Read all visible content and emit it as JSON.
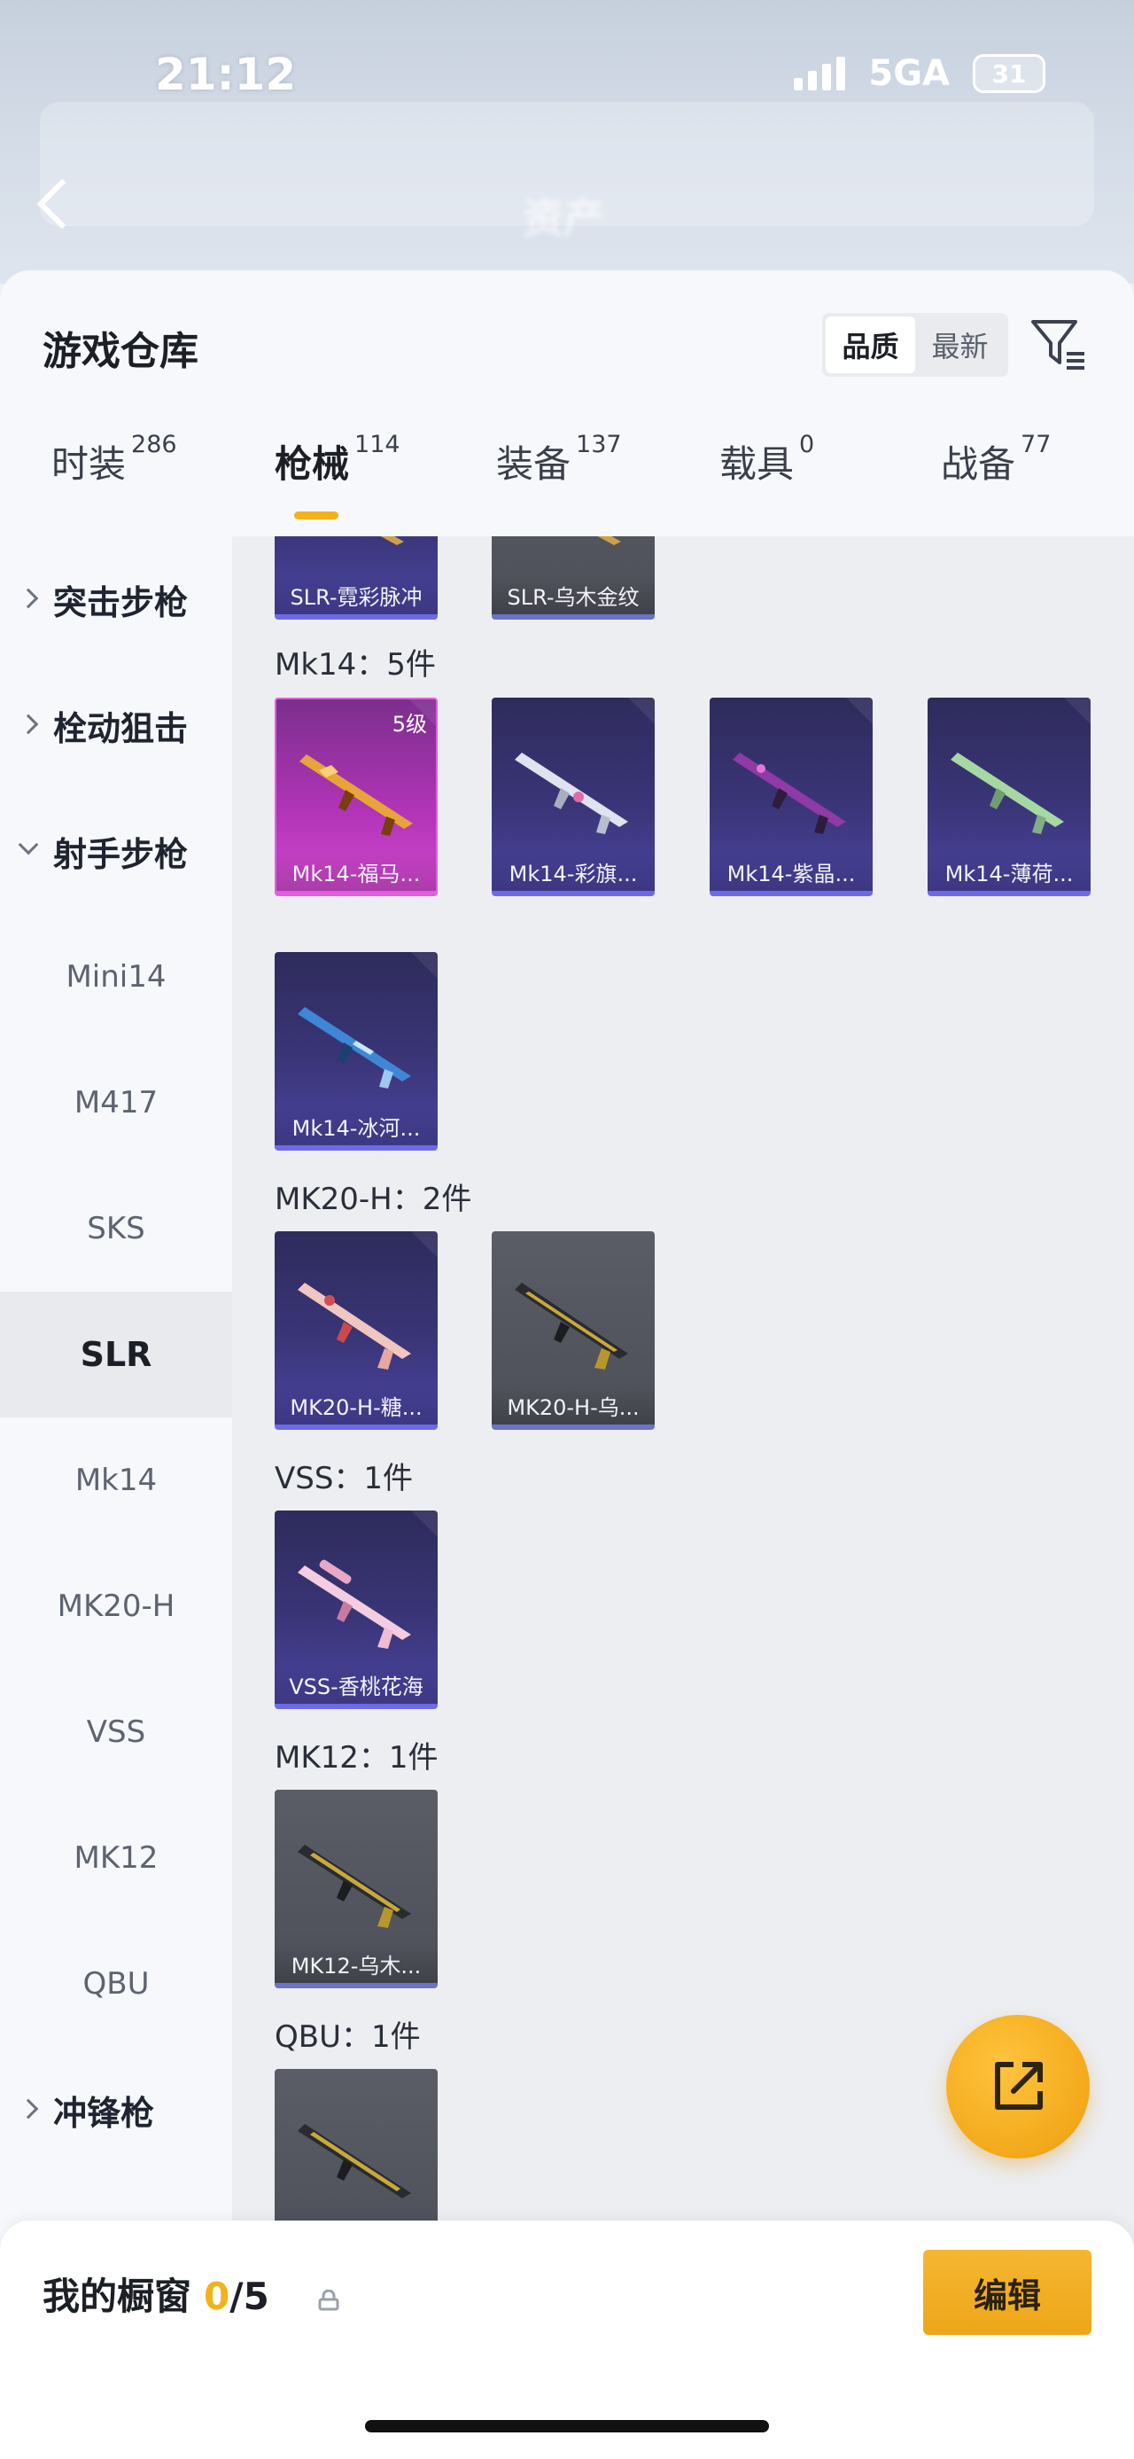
{
  "status_bar": {
    "time": "21:12",
    "network": "5GA",
    "battery": "31"
  },
  "background_header": {
    "title": "资产"
  },
  "header": {
    "title": "游戏仓库",
    "sort_options": [
      {
        "label": "品质",
        "active": true
      },
      {
        "label": "最新",
        "active": false
      }
    ]
  },
  "tabs": [
    {
      "label": "时装",
      "count": "286",
      "active": false
    },
    {
      "label": "枪械",
      "count": "114",
      "active": true
    },
    {
      "label": "装备",
      "count": "137",
      "active": false
    },
    {
      "label": "载具",
      "count": "0",
      "active": false
    },
    {
      "label": "战备",
      "count": "77",
      "active": false
    }
  ],
  "sidebar": {
    "items": [
      {
        "label": "突击步枪",
        "type": "group",
        "expanded": false
      },
      {
        "label": "栓动狙击",
        "type": "group",
        "expanded": false
      },
      {
        "label": "射手步枪",
        "type": "group",
        "expanded": true
      },
      {
        "label": "Mini14",
        "type": "sub"
      },
      {
        "label": "M417",
        "type": "sub"
      },
      {
        "label": "SKS",
        "type": "sub"
      },
      {
        "label": "SLR",
        "type": "sub",
        "active": true
      },
      {
        "label": "Mk14",
        "type": "sub"
      },
      {
        "label": "MK20-H",
        "type": "sub"
      },
      {
        "label": "VSS",
        "type": "sub"
      },
      {
        "label": "MK12",
        "type": "sub"
      },
      {
        "label": "QBU",
        "type": "sub"
      },
      {
        "label": "冲锋枪",
        "type": "group",
        "expanded": false
      }
    ]
  },
  "content": {
    "sections": [
      {
        "label": "",
        "items": [
          {
            "name": "SLR-霓彩脉冲",
            "quality": "purple"
          },
          {
            "name": "SLR-乌木金纹",
            "quality": "gray"
          }
        ]
      },
      {
        "label": "Mk14：5件",
        "items": [
          {
            "name": "Mk14-福马...",
            "quality": "pink",
            "level": "5级"
          },
          {
            "name": "Mk14-彩旗...",
            "quality": "purple"
          },
          {
            "name": "Mk14-紫晶...",
            "quality": "purple"
          },
          {
            "name": "Mk14-薄荷...",
            "quality": "purple"
          },
          {
            "name": "Mk14-冰河...",
            "quality": "purple"
          }
        ]
      },
      {
        "label": "MK20-H：2件",
        "items": [
          {
            "name": "MK20-H-糖...",
            "quality": "purple"
          },
          {
            "name": "MK20-H-乌...",
            "quality": "gray"
          }
        ]
      },
      {
        "label": "VSS：1件",
        "items": [
          {
            "name": "VSS-香桃花海",
            "quality": "purple"
          }
        ]
      },
      {
        "label": "MK12：1件",
        "items": [
          {
            "name": "MK12-乌木...",
            "quality": "gray"
          }
        ]
      },
      {
        "label": "QBU：1件",
        "items": [
          {
            "name": "",
            "quality": "gray"
          }
        ]
      }
    ]
  },
  "showcase": {
    "title": "我的橱窗",
    "used": "0",
    "total": "/5",
    "edit_label": "编辑"
  },
  "colors": {
    "accent": "#f2b21c",
    "quality_purple": "#3a3577",
    "quality_pink": "#b334b8",
    "quality_gray": "#52555d"
  },
  "icons": [
    "back-icon",
    "filter-icon",
    "lock-icon",
    "share-icon",
    "chevron-right-icon",
    "chevron-down-icon"
  ]
}
